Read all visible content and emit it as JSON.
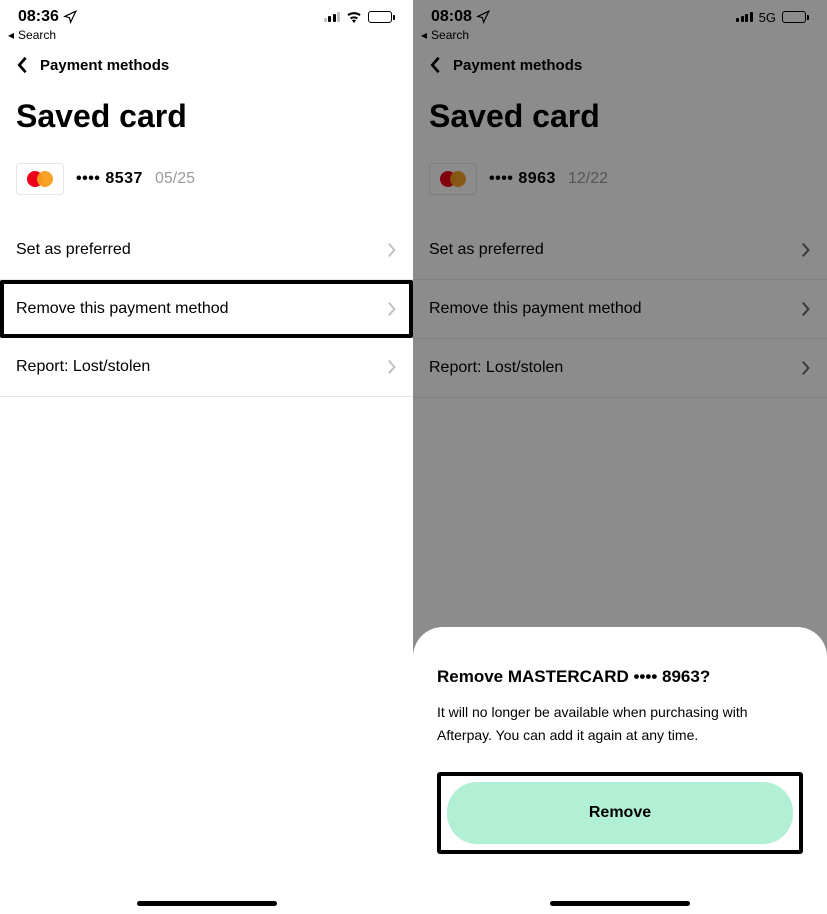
{
  "left": {
    "status": {
      "time": "08:36",
      "back_search": "Search"
    },
    "nav_label": "Payment methods",
    "title": "Saved card",
    "card": {
      "masked": "•••• 8537",
      "expiry": "05/25"
    },
    "rows": {
      "set_preferred": "Set as preferred",
      "remove": "Remove this payment method",
      "report": "Report: Lost/stolen"
    }
  },
  "right": {
    "status": {
      "time": "08:08",
      "network": "5G",
      "back_search": "Search"
    },
    "nav_label": "Payment methods",
    "title": "Saved card",
    "card": {
      "masked": "•••• 8963",
      "expiry": "12/22"
    },
    "rows": {
      "set_preferred": "Set as preferred",
      "remove": "Remove this payment method",
      "report": "Report: Lost/stolen"
    },
    "sheet": {
      "title": "Remove MASTERCARD •••• 8963?",
      "body": "It will no longer be available when purchasing with Afterpay. You can add it again at any time.",
      "button": "Remove"
    }
  }
}
